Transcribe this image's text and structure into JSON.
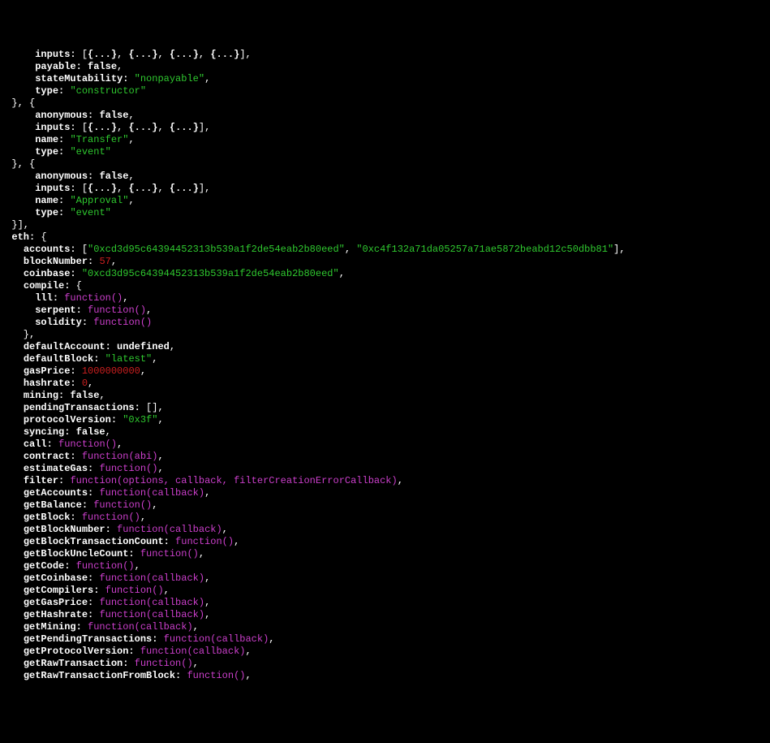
{
  "lines": [
    {
      "t": [
        {
          "c": "w",
          "v": "      "
        },
        {
          "c": "k",
          "v": "inputs:"
        },
        {
          "c": "w",
          "v": " ["
        },
        {
          "c": "b",
          "v": "{...}"
        },
        {
          "c": "w",
          "v": ", "
        },
        {
          "c": "b",
          "v": "{...}"
        },
        {
          "c": "w",
          "v": ", "
        },
        {
          "c": "b",
          "v": "{...}"
        },
        {
          "c": "w",
          "v": ", "
        },
        {
          "c": "b",
          "v": "{...}"
        },
        {
          "c": "w",
          "v": "],"
        }
      ]
    },
    {
      "t": [
        {
          "c": "w",
          "v": "      "
        },
        {
          "c": "k",
          "v": "payable:"
        },
        {
          "c": "w",
          "v": " "
        },
        {
          "c": "b",
          "v": "false"
        },
        {
          "c": "w",
          "v": ","
        }
      ]
    },
    {
      "t": [
        {
          "c": "w",
          "v": "      "
        },
        {
          "c": "k",
          "v": "stateMutability:"
        },
        {
          "c": "w",
          "v": " "
        },
        {
          "c": "s",
          "v": "\"nonpayable\""
        },
        {
          "c": "w",
          "v": ","
        }
      ]
    },
    {
      "t": [
        {
          "c": "w",
          "v": "      "
        },
        {
          "c": "k",
          "v": "type:"
        },
        {
          "c": "w",
          "v": " "
        },
        {
          "c": "s",
          "v": "\"constructor\""
        }
      ]
    },
    {
      "t": [
        {
          "c": "w",
          "v": "  }, {"
        }
      ]
    },
    {
      "t": [
        {
          "c": "w",
          "v": "      "
        },
        {
          "c": "k",
          "v": "anonymous:"
        },
        {
          "c": "w",
          "v": " "
        },
        {
          "c": "b",
          "v": "false"
        },
        {
          "c": "w",
          "v": ","
        }
      ]
    },
    {
      "t": [
        {
          "c": "w",
          "v": "      "
        },
        {
          "c": "k",
          "v": "inputs:"
        },
        {
          "c": "w",
          "v": " ["
        },
        {
          "c": "b",
          "v": "{...}"
        },
        {
          "c": "w",
          "v": ", "
        },
        {
          "c": "b",
          "v": "{...}"
        },
        {
          "c": "w",
          "v": ", "
        },
        {
          "c": "b",
          "v": "{...}"
        },
        {
          "c": "w",
          "v": "],"
        }
      ]
    },
    {
      "t": [
        {
          "c": "w",
          "v": "      "
        },
        {
          "c": "k",
          "v": "name:"
        },
        {
          "c": "w",
          "v": " "
        },
        {
          "c": "s",
          "v": "\"Transfer\""
        },
        {
          "c": "w",
          "v": ","
        }
      ]
    },
    {
      "t": [
        {
          "c": "w",
          "v": "      "
        },
        {
          "c": "k",
          "v": "type:"
        },
        {
          "c": "w",
          "v": " "
        },
        {
          "c": "s",
          "v": "\"event\""
        }
      ]
    },
    {
      "t": [
        {
          "c": "w",
          "v": "  }, {"
        }
      ]
    },
    {
      "t": [
        {
          "c": "w",
          "v": "      "
        },
        {
          "c": "k",
          "v": "anonymous:"
        },
        {
          "c": "w",
          "v": " "
        },
        {
          "c": "b",
          "v": "false"
        },
        {
          "c": "w",
          "v": ","
        }
      ]
    },
    {
      "t": [
        {
          "c": "w",
          "v": "      "
        },
        {
          "c": "k",
          "v": "inputs:"
        },
        {
          "c": "w",
          "v": " ["
        },
        {
          "c": "b",
          "v": "{...}"
        },
        {
          "c": "w",
          "v": ", "
        },
        {
          "c": "b",
          "v": "{...}"
        },
        {
          "c": "w",
          "v": ", "
        },
        {
          "c": "b",
          "v": "{...}"
        },
        {
          "c": "w",
          "v": "],"
        }
      ]
    },
    {
      "t": [
        {
          "c": "w",
          "v": "      "
        },
        {
          "c": "k",
          "v": "name:"
        },
        {
          "c": "w",
          "v": " "
        },
        {
          "c": "s",
          "v": "\"Approval\""
        },
        {
          "c": "w",
          "v": ","
        }
      ]
    },
    {
      "t": [
        {
          "c": "w",
          "v": "      "
        },
        {
          "c": "k",
          "v": "type:"
        },
        {
          "c": "w",
          "v": " "
        },
        {
          "c": "s",
          "v": "\"event\""
        }
      ]
    },
    {
      "t": [
        {
          "c": "w",
          "v": "  }],"
        }
      ]
    },
    {
      "t": [
        {
          "c": "w",
          "v": "  "
        },
        {
          "c": "k",
          "v": "eth:"
        },
        {
          "c": "w",
          "v": " {"
        }
      ]
    },
    {
      "t": [
        {
          "c": "w",
          "v": "    "
        },
        {
          "c": "k",
          "v": "accounts:"
        },
        {
          "c": "w",
          "v": " ["
        },
        {
          "c": "s",
          "v": "\"0xcd3d95c64394452313b539a1f2de54eab2b80eed\""
        },
        {
          "c": "w",
          "v": ", "
        },
        {
          "c": "s",
          "v": "\"0xc4f132a71da05257a71ae5872beabd12c50dbb81\""
        },
        {
          "c": "w",
          "v": "],"
        }
      ]
    },
    {
      "t": [
        {
          "c": "w",
          "v": "    "
        },
        {
          "c": "k",
          "v": "blockNumber:"
        },
        {
          "c": "w",
          "v": " "
        },
        {
          "c": "n",
          "v": "57"
        },
        {
          "c": "w",
          "v": ","
        }
      ]
    },
    {
      "t": [
        {
          "c": "w",
          "v": "    "
        },
        {
          "c": "k",
          "v": "coinbase:"
        },
        {
          "c": "w",
          "v": " "
        },
        {
          "c": "s",
          "v": "\"0xcd3d95c64394452313b539a1f2de54eab2b80eed\""
        },
        {
          "c": "w",
          "v": ","
        }
      ]
    },
    {
      "t": [
        {
          "c": "w",
          "v": "    "
        },
        {
          "c": "k",
          "v": "compile:"
        },
        {
          "c": "w",
          "v": " {"
        }
      ]
    },
    {
      "t": [
        {
          "c": "w",
          "v": "      "
        },
        {
          "c": "k",
          "v": "lll:"
        },
        {
          "c": "w",
          "v": " "
        },
        {
          "c": "fn",
          "v": "function()"
        },
        {
          "c": "w",
          "v": ","
        }
      ]
    },
    {
      "t": [
        {
          "c": "w",
          "v": "      "
        },
        {
          "c": "k",
          "v": "serpent:"
        },
        {
          "c": "w",
          "v": " "
        },
        {
          "c": "fn",
          "v": "function()"
        },
        {
          "c": "w",
          "v": ","
        }
      ]
    },
    {
      "t": [
        {
          "c": "w",
          "v": "      "
        },
        {
          "c": "k",
          "v": "solidity:"
        },
        {
          "c": "w",
          "v": " "
        },
        {
          "c": "fn",
          "v": "function()"
        }
      ]
    },
    {
      "t": [
        {
          "c": "w",
          "v": "    },"
        }
      ]
    },
    {
      "t": [
        {
          "c": "w",
          "v": "    "
        },
        {
          "c": "k",
          "v": "defaultAccount:"
        },
        {
          "c": "w",
          "v": " "
        },
        {
          "c": "b",
          "v": "undefined"
        },
        {
          "c": "w",
          "v": ","
        }
      ]
    },
    {
      "t": [
        {
          "c": "w",
          "v": "    "
        },
        {
          "c": "k",
          "v": "defaultBlock:"
        },
        {
          "c": "w",
          "v": " "
        },
        {
          "c": "s",
          "v": "\"latest\""
        },
        {
          "c": "w",
          "v": ","
        }
      ]
    },
    {
      "t": [
        {
          "c": "w",
          "v": "    "
        },
        {
          "c": "k",
          "v": "gasPrice:"
        },
        {
          "c": "w",
          "v": " "
        },
        {
          "c": "n",
          "v": "1000000000"
        },
        {
          "c": "w",
          "v": ","
        }
      ]
    },
    {
      "t": [
        {
          "c": "w",
          "v": "    "
        },
        {
          "c": "k",
          "v": "hashrate:"
        },
        {
          "c": "w",
          "v": " "
        },
        {
          "c": "n",
          "v": "0"
        },
        {
          "c": "w",
          "v": ","
        }
      ]
    },
    {
      "t": [
        {
          "c": "w",
          "v": "    "
        },
        {
          "c": "k",
          "v": "mining:"
        },
        {
          "c": "w",
          "v": " "
        },
        {
          "c": "b",
          "v": "false"
        },
        {
          "c": "w",
          "v": ","
        }
      ]
    },
    {
      "t": [
        {
          "c": "w",
          "v": "    "
        },
        {
          "c": "k",
          "v": "pendingTransactions:"
        },
        {
          "c": "w",
          "v": " [],"
        }
      ]
    },
    {
      "t": [
        {
          "c": "w",
          "v": "    "
        },
        {
          "c": "k",
          "v": "protocolVersion:"
        },
        {
          "c": "w",
          "v": " "
        },
        {
          "c": "s",
          "v": "\"0x3f\""
        },
        {
          "c": "w",
          "v": ","
        }
      ]
    },
    {
      "t": [
        {
          "c": "w",
          "v": "    "
        },
        {
          "c": "k",
          "v": "syncing:"
        },
        {
          "c": "w",
          "v": " "
        },
        {
          "c": "b",
          "v": "false"
        },
        {
          "c": "w",
          "v": ","
        }
      ]
    },
    {
      "t": [
        {
          "c": "w",
          "v": "    "
        },
        {
          "c": "k",
          "v": "call:"
        },
        {
          "c": "w",
          "v": " "
        },
        {
          "c": "fn",
          "v": "function()"
        },
        {
          "c": "w",
          "v": ","
        }
      ]
    },
    {
      "t": [
        {
          "c": "w",
          "v": "    "
        },
        {
          "c": "k",
          "v": "contract:"
        },
        {
          "c": "w",
          "v": " "
        },
        {
          "c": "fn",
          "v": "function(abi)"
        },
        {
          "c": "w",
          "v": ","
        }
      ]
    },
    {
      "t": [
        {
          "c": "w",
          "v": "    "
        },
        {
          "c": "k",
          "v": "estimateGas:"
        },
        {
          "c": "w",
          "v": " "
        },
        {
          "c": "fn",
          "v": "function()"
        },
        {
          "c": "w",
          "v": ","
        }
      ]
    },
    {
      "t": [
        {
          "c": "w",
          "v": "    "
        },
        {
          "c": "k",
          "v": "filter:"
        },
        {
          "c": "w",
          "v": " "
        },
        {
          "c": "fn",
          "v": "function(options, callback, filterCreationErrorCallback)"
        },
        {
          "c": "w",
          "v": ","
        }
      ]
    },
    {
      "t": [
        {
          "c": "w",
          "v": "    "
        },
        {
          "c": "k",
          "v": "getAccounts:"
        },
        {
          "c": "w",
          "v": " "
        },
        {
          "c": "fn",
          "v": "function(callback)"
        },
        {
          "c": "w",
          "v": ","
        }
      ]
    },
    {
      "t": [
        {
          "c": "w",
          "v": "    "
        },
        {
          "c": "k",
          "v": "getBalance:"
        },
        {
          "c": "w",
          "v": " "
        },
        {
          "c": "fn",
          "v": "function()"
        },
        {
          "c": "w",
          "v": ","
        }
      ]
    },
    {
      "t": [
        {
          "c": "w",
          "v": "    "
        },
        {
          "c": "k",
          "v": "getBlock:"
        },
        {
          "c": "w",
          "v": " "
        },
        {
          "c": "fn",
          "v": "function()"
        },
        {
          "c": "w",
          "v": ","
        }
      ]
    },
    {
      "t": [
        {
          "c": "w",
          "v": "    "
        },
        {
          "c": "k",
          "v": "getBlockNumber:"
        },
        {
          "c": "w",
          "v": " "
        },
        {
          "c": "fn",
          "v": "function(callback)"
        },
        {
          "c": "w",
          "v": ","
        }
      ]
    },
    {
      "t": [
        {
          "c": "w",
          "v": "    "
        },
        {
          "c": "k",
          "v": "getBlockTransactionCount:"
        },
        {
          "c": "w",
          "v": " "
        },
        {
          "c": "fn",
          "v": "function()"
        },
        {
          "c": "w",
          "v": ","
        }
      ]
    },
    {
      "t": [
        {
          "c": "w",
          "v": "    "
        },
        {
          "c": "k",
          "v": "getBlockUncleCount:"
        },
        {
          "c": "w",
          "v": " "
        },
        {
          "c": "fn",
          "v": "function()"
        },
        {
          "c": "w",
          "v": ","
        }
      ]
    },
    {
      "t": [
        {
          "c": "w",
          "v": "    "
        },
        {
          "c": "k",
          "v": "getCode:"
        },
        {
          "c": "w",
          "v": " "
        },
        {
          "c": "fn",
          "v": "function()"
        },
        {
          "c": "w",
          "v": ","
        }
      ]
    },
    {
      "t": [
        {
          "c": "w",
          "v": "    "
        },
        {
          "c": "k",
          "v": "getCoinbase:"
        },
        {
          "c": "w",
          "v": " "
        },
        {
          "c": "fn",
          "v": "function(callback)"
        },
        {
          "c": "w",
          "v": ","
        }
      ]
    },
    {
      "t": [
        {
          "c": "w",
          "v": "    "
        },
        {
          "c": "k",
          "v": "getCompilers:"
        },
        {
          "c": "w",
          "v": " "
        },
        {
          "c": "fn",
          "v": "function()"
        },
        {
          "c": "w",
          "v": ","
        }
      ]
    },
    {
      "t": [
        {
          "c": "w",
          "v": "    "
        },
        {
          "c": "k",
          "v": "getGasPrice:"
        },
        {
          "c": "w",
          "v": " "
        },
        {
          "c": "fn",
          "v": "function(callback)"
        },
        {
          "c": "w",
          "v": ","
        }
      ]
    },
    {
      "t": [
        {
          "c": "w",
          "v": "    "
        },
        {
          "c": "k",
          "v": "getHashrate:"
        },
        {
          "c": "w",
          "v": " "
        },
        {
          "c": "fn",
          "v": "function(callback)"
        },
        {
          "c": "w",
          "v": ","
        }
      ]
    },
    {
      "t": [
        {
          "c": "w",
          "v": "    "
        },
        {
          "c": "k",
          "v": "getMining:"
        },
        {
          "c": "w",
          "v": " "
        },
        {
          "c": "fn",
          "v": "function(callback)"
        },
        {
          "c": "w",
          "v": ","
        }
      ]
    },
    {
      "t": [
        {
          "c": "w",
          "v": "    "
        },
        {
          "c": "k",
          "v": "getPendingTransactions:"
        },
        {
          "c": "w",
          "v": " "
        },
        {
          "c": "fn",
          "v": "function(callback)"
        },
        {
          "c": "w",
          "v": ","
        }
      ]
    },
    {
      "t": [
        {
          "c": "w",
          "v": "    "
        },
        {
          "c": "k",
          "v": "getProtocolVersion:"
        },
        {
          "c": "w",
          "v": " "
        },
        {
          "c": "fn",
          "v": "function(callback)"
        },
        {
          "c": "w",
          "v": ","
        }
      ]
    },
    {
      "t": [
        {
          "c": "w",
          "v": "    "
        },
        {
          "c": "k",
          "v": "getRawTransaction:"
        },
        {
          "c": "w",
          "v": " "
        },
        {
          "c": "fn",
          "v": "function()"
        },
        {
          "c": "w",
          "v": ","
        }
      ]
    },
    {
      "t": [
        {
          "c": "w",
          "v": "    "
        },
        {
          "c": "k",
          "v": "getRawTransactionFromBlock:"
        },
        {
          "c": "w",
          "v": " "
        },
        {
          "c": "fn",
          "v": "function()"
        },
        {
          "c": "w",
          "v": ","
        }
      ]
    }
  ]
}
